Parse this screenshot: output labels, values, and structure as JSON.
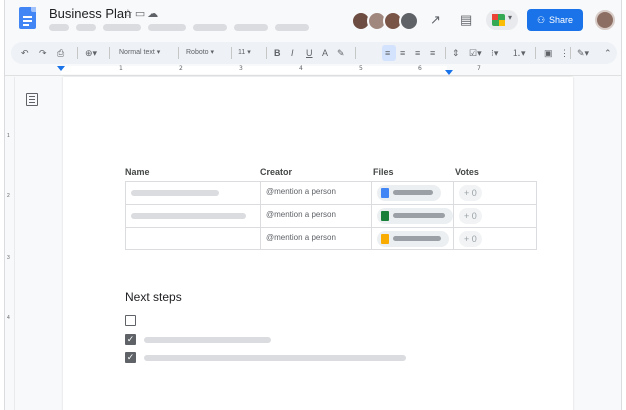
{
  "header": {
    "title": "Business Plan",
    "share_label": "Share"
  },
  "toolbar": {
    "style": "Normal text",
    "font": "Roboto",
    "size": "11"
  },
  "ruler": {
    "numbers": [
      "1",
      "2",
      "3",
      "4",
      "5",
      "6",
      "7"
    ]
  },
  "vruler": {
    "numbers": [
      "1",
      "2",
      "3",
      "4"
    ]
  },
  "table": {
    "headers": [
      "Name",
      "Creator",
      "Files",
      "Votes"
    ],
    "rows": [
      {
        "creator": "@mention a person",
        "file_type": "docs",
        "vote": "+ 0"
      },
      {
        "creator": "@mention a person",
        "file_type": "sheets",
        "vote": "+ 0"
      },
      {
        "creator": "@mention a person",
        "file_type": "slides",
        "vote": "+ 0"
      }
    ]
  },
  "next_steps": {
    "heading": "Next steps",
    "items": [
      {
        "checked": false
      },
      {
        "checked": true
      },
      {
        "checked": true
      }
    ]
  },
  "colors": {
    "accent": "#1a73e8",
    "docs": "#4285f4",
    "sheets": "#188038",
    "slides": "#f9ab00"
  }
}
